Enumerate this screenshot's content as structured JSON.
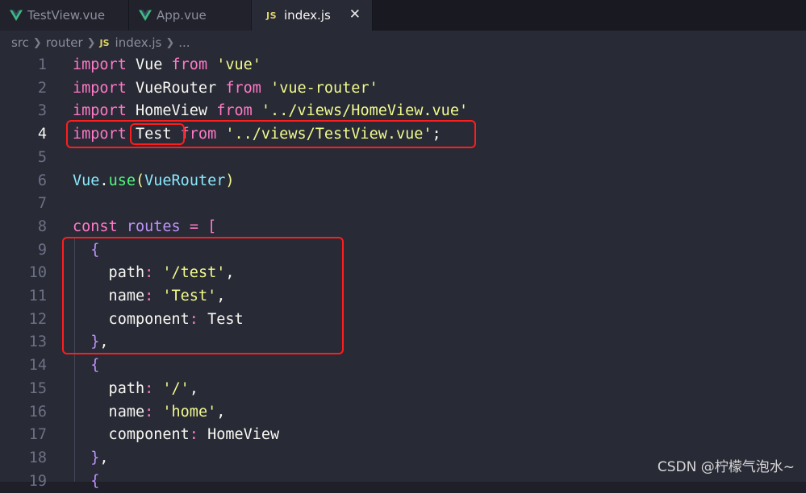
{
  "tabs": [
    {
      "label": "TestView.vue",
      "icon": "vue-icon"
    },
    {
      "label": "App.vue",
      "icon": "vue-icon"
    },
    {
      "label": "index.js",
      "icon": "js-icon",
      "icon_text": "JS",
      "active": true,
      "close": "✕"
    }
  ],
  "breadcrumb": {
    "items": [
      "src",
      "router",
      "index.js",
      "..."
    ],
    "icon_text": "JS"
  },
  "lines": [
    {
      "n": "1",
      "code": [
        [
          "kw",
          "import"
        ],
        [
          "ident",
          " Vue "
        ],
        [
          "kw",
          "from"
        ],
        [
          "ident",
          " "
        ],
        [
          "str",
          "'vue'"
        ]
      ]
    },
    {
      "n": "2",
      "code": [
        [
          "kw",
          "import"
        ],
        [
          "ident",
          " VueRouter "
        ],
        [
          "kw",
          "from"
        ],
        [
          "ident",
          " "
        ],
        [
          "str",
          "'vue-router'"
        ]
      ]
    },
    {
      "n": "3",
      "code": [
        [
          "kw",
          "import"
        ],
        [
          "ident",
          " HomeView "
        ],
        [
          "kw",
          "from"
        ],
        [
          "ident",
          " "
        ],
        [
          "str",
          "'../views/HomeView.vue'"
        ]
      ]
    },
    {
      "n": "4",
      "code": [
        [
          "kw",
          "import"
        ],
        [
          "ident",
          " Test "
        ],
        [
          "kw",
          "from"
        ],
        [
          "ident",
          " "
        ],
        [
          "str",
          "'../views/TestView.vue'"
        ],
        [
          "ident",
          ";"
        ]
      ]
    },
    {
      "n": "5",
      "code": []
    },
    {
      "n": "6",
      "code": [
        [
          "cls",
          "Vue"
        ],
        [
          "ident",
          "."
        ],
        [
          "fn",
          "use"
        ],
        [
          "paren",
          "("
        ],
        [
          "cls",
          "VueRouter"
        ],
        [
          "paren",
          ")"
        ]
      ]
    },
    {
      "n": "7",
      "code": []
    },
    {
      "n": "8",
      "code": [
        [
          "kw",
          "const"
        ],
        [
          "ident",
          " "
        ],
        [
          "var",
          "routes"
        ],
        [
          "ident",
          " "
        ],
        [
          "kw",
          "="
        ],
        [
          "ident",
          " "
        ],
        [
          "brace",
          "["
        ]
      ]
    },
    {
      "n": "9",
      "code": [
        [
          "ident",
          "  "
        ],
        [
          "brace2",
          "{"
        ]
      ]
    },
    {
      "n": "10",
      "code": [
        [
          "ident",
          "    path"
        ],
        [
          "kw",
          ":"
        ],
        [
          "ident",
          " "
        ],
        [
          "str",
          "'/test'"
        ],
        [
          "ident",
          ","
        ]
      ]
    },
    {
      "n": "11",
      "code": [
        [
          "ident",
          "    name"
        ],
        [
          "kw",
          ":"
        ],
        [
          "ident",
          " "
        ],
        [
          "str",
          "'Test'"
        ],
        [
          "ident",
          ","
        ]
      ]
    },
    {
      "n": "12",
      "code": [
        [
          "ident",
          "    component"
        ],
        [
          "kw",
          ":"
        ],
        [
          "ident",
          " Test"
        ]
      ]
    },
    {
      "n": "13",
      "code": [
        [
          "ident",
          "  "
        ],
        [
          "brace2",
          "}"
        ],
        [
          "ident",
          ","
        ]
      ]
    },
    {
      "n": "14",
      "code": [
        [
          "ident",
          "  "
        ],
        [
          "brace2",
          "{"
        ]
      ]
    },
    {
      "n": "15",
      "code": [
        [
          "ident",
          "    path"
        ],
        [
          "kw",
          ":"
        ],
        [
          "ident",
          " "
        ],
        [
          "str",
          "'/'"
        ],
        [
          "ident",
          ","
        ]
      ]
    },
    {
      "n": "16",
      "code": [
        [
          "ident",
          "    name"
        ],
        [
          "kw",
          ":"
        ],
        [
          "ident",
          " "
        ],
        [
          "str",
          "'home'"
        ],
        [
          "ident",
          ","
        ]
      ]
    },
    {
      "n": "17",
      "code": [
        [
          "ident",
          "    component"
        ],
        [
          "kw",
          ":"
        ],
        [
          "ident",
          " HomeView"
        ]
      ]
    },
    {
      "n": "18",
      "code": [
        [
          "ident",
          "  "
        ],
        [
          "brace2",
          "}"
        ],
        [
          "ident",
          ","
        ]
      ]
    },
    {
      "n": "19",
      "code": [
        [
          "ident",
          "  "
        ],
        [
          "brace2",
          "{"
        ]
      ]
    }
  ],
  "active_line": "4",
  "colors": {
    "highlight_box": "#ff1d1d",
    "keyword": "#ff79c6",
    "string": "#f1fa8c"
  },
  "watermark": "CSDN @柠檬气泡水~"
}
